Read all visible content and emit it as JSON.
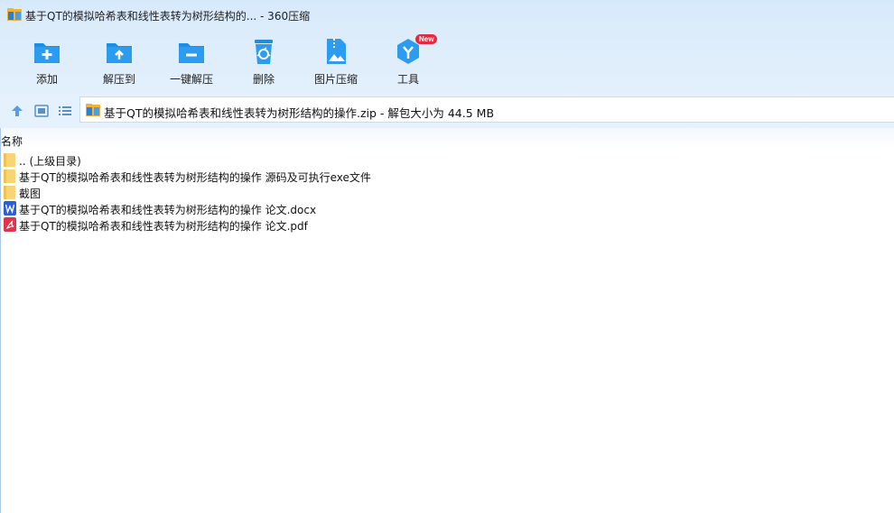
{
  "window": {
    "title": "基于QT的模拟哈希表和线性表转为树形结构的... - 360压缩"
  },
  "toolbar": {
    "items": [
      {
        "label": "添加",
        "icon": "add-folder-icon"
      },
      {
        "label": "解压到",
        "icon": "extract-to-icon"
      },
      {
        "label": "一键解压",
        "icon": "one-click-extract-icon"
      },
      {
        "label": "删除",
        "icon": "recycle-bin-icon"
      },
      {
        "label": "图片压缩",
        "icon": "image-compress-icon"
      },
      {
        "label": "工具",
        "icon": "tools-icon",
        "badge": "New"
      }
    ]
  },
  "address": {
    "path": "基于QT的模拟哈希表和线性表转为树形结构的操作.zip - 解包大小为 44.5 MB"
  },
  "columns": {
    "name": "名称"
  },
  "files": [
    {
      "name": ".. (上级目录)",
      "icon": "folder-icon"
    },
    {
      "name": "基于QT的模拟哈希表和线性表转为树形结构的操作 源码及可执行exe文件",
      "icon": "folder-icon"
    },
    {
      "name": "截图",
      "icon": "folder-icon"
    },
    {
      "name": "基于QT的模拟哈希表和线性表转为树形结构的操作 论文.docx",
      "icon": "word-doc-icon"
    },
    {
      "name": "基于QT的模拟哈希表和线性表转为树形结构的操作 论文.pdf",
      "icon": "pdf-icon"
    }
  ],
  "colors": {
    "accent": "#1e8fe0",
    "toolbar_bg": "#dcecfb",
    "folder": "#f7d577",
    "badge": "#e8283c"
  }
}
